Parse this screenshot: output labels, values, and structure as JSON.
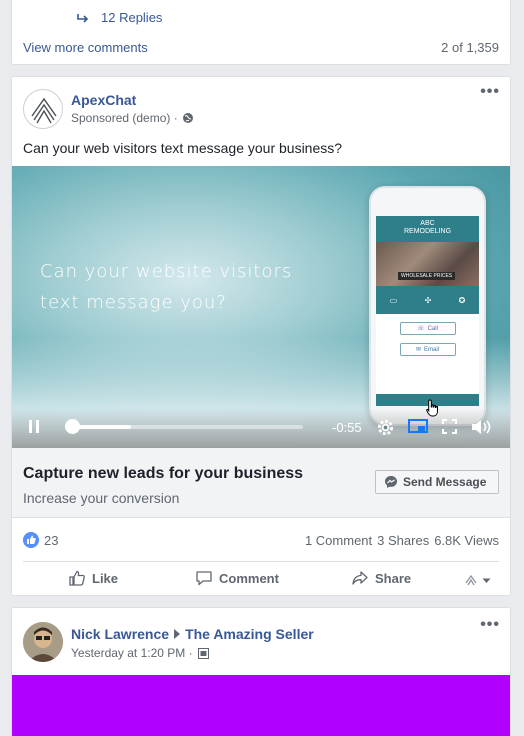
{
  "top_card": {
    "replies_label": "12 Replies",
    "view_more_label": "View more comments",
    "pager": "2 of 1,359"
  },
  "ad": {
    "page_name": "ApexChat",
    "sponsored": "Sponsored (demo) ·",
    "text": "Can your web visitors text message your business?",
    "video": {
      "headline_line1": "Can your website visitors",
      "headline_line2": "text message you?",
      "time_remaining": "-0:55",
      "progress_fraction": 0.27,
      "phone": {
        "brand_line1": "ABC",
        "brand_line2": "REMODELING",
        "ribbon": "WHOLESALE PRICES",
        "call_label": "Call",
        "email_label": "Email"
      }
    },
    "cta": {
      "title": "Capture new leads for your business",
      "subtitle": "Increase your conversion",
      "button_label": "Send Message"
    },
    "stats": {
      "likes": "23",
      "comments": "1 Comment",
      "shares": "3 Shares",
      "views": "6.8K Views"
    },
    "actions": {
      "like": "Like",
      "comment": "Comment",
      "share": "Share"
    }
  },
  "post": {
    "author": "Nick Lawrence",
    "target": "The Amazing Seller",
    "time": "Yesterday at 1:20 PM ·",
    "media_color": "#b000ff"
  },
  "colors": {
    "link": "#385898",
    "background": "#e9ebee",
    "like_blue": "#5890ff"
  }
}
